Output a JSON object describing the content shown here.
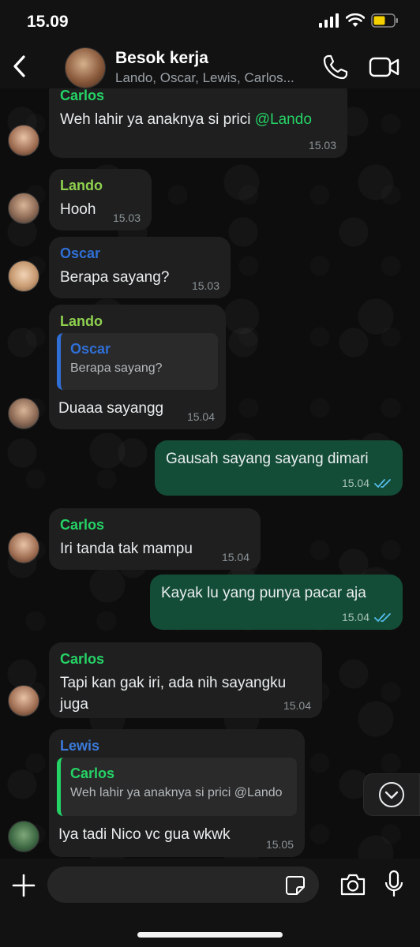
{
  "status_bar": {
    "time": "15.09"
  },
  "header": {
    "group_name": "Besok kerja",
    "members": "Lando, Oscar, Lewis, Carlos..."
  },
  "messages": [
    {
      "sender": "Carlos",
      "text_before": "Weh lahir ya anaknya si prici ",
      "mention": "@Lando",
      "time": "15.03"
    },
    {
      "sender": "Lando",
      "text": "Hooh",
      "time": "15.03"
    },
    {
      "sender": "Oscar",
      "text": "Berapa sayang?",
      "time": "15.03"
    },
    {
      "sender": "Lando",
      "quote_sender": "Oscar",
      "quote_text": "Berapa sayang?",
      "text": "Duaaa sayangg",
      "time": "15.04"
    },
    {
      "text": "Gausah sayang sayang dimari",
      "time": "15.04"
    },
    {
      "sender": "Carlos",
      "text": "Iri tanda tak mampu",
      "time": "15.04"
    },
    {
      "text": "Kayak lu yang punya pacar aja",
      "time": "15.04"
    },
    {
      "sender": "Carlos",
      "line1": "Tapi kan gak iri, ada nih sayangku",
      "line2": "juga",
      "time": "15.04"
    },
    {
      "sender": "Lewis",
      "quote_sender": "Carlos",
      "quote_text": "Weh lahir ya anaknya si prici @Lando",
      "text": "Iya tadi Nico vc gua wkwk",
      "time": "15.05"
    }
  ],
  "colors": {
    "carlos": "#25d366",
    "lando": "#8fd14f",
    "oscar": "#2f6fd6",
    "lewis": "#3b7bdc",
    "outgoing_bubble": "#144d37",
    "incoming_bubble": "#1f1f1f",
    "read_ticks": "#53bdeb"
  },
  "composer": {
    "placeholder": ""
  }
}
